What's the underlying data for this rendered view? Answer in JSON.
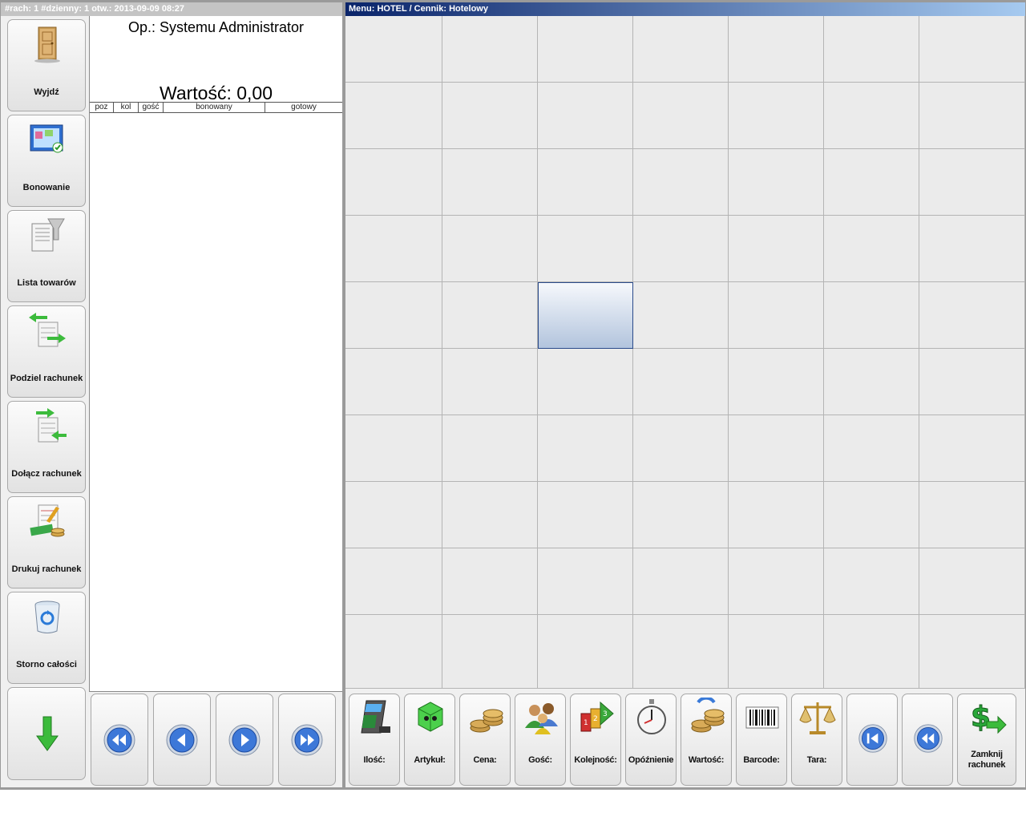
{
  "left_title": "#rach: 1 #dzienny: 1 otw.: 2013-09-09 08:27",
  "operator": "Op.: Systemu Administrator",
  "total": "Wartość: 0,00",
  "columns": [
    "poz",
    "kol",
    "gość",
    "bonowany",
    "gotowy"
  ],
  "sidebar": [
    {
      "label": "Wyjdź",
      "icon": "door-icon"
    },
    {
      "label": "Bonowanie",
      "icon": "order-screen-icon"
    },
    {
      "label": "Lista towarów",
      "icon": "product-list-icon"
    },
    {
      "label": "Podziel rachunek",
      "icon": "split-bill-icon"
    },
    {
      "label": "Dołącz rachunek",
      "icon": "merge-bill-icon"
    },
    {
      "label": "Drukuj rachunek",
      "icon": "print-bill-icon"
    },
    {
      "label": "Storno całości",
      "icon": "recycle-bin-icon"
    }
  ],
  "sidebar_scroll_icon": "arrow-down-icon",
  "order_nav_icons": [
    "rewind-icon",
    "previous-icon",
    "next-icon",
    "fast-forward-icon"
  ],
  "right_title": "Menu: HOTEL / Cennik: Hotelowy",
  "grid": {
    "rows": 10,
    "cols": 7,
    "selected_row": 4,
    "selected_col": 2
  },
  "function_buttons": [
    {
      "label": "Ilość:",
      "icon": "calculator-icon"
    },
    {
      "label": "Artykuł:",
      "icon": "article-icon"
    },
    {
      "label": "Cena:",
      "icon": "coins-icon"
    },
    {
      "label": "Gość:",
      "icon": "guests-icon"
    },
    {
      "label": "Kolejność:",
      "icon": "sequence-icon"
    },
    {
      "label": "Opóźnienie",
      "icon": "stopwatch-icon"
    },
    {
      "label": "Wartość:",
      "icon": "value-coins-icon"
    },
    {
      "label": "Barcode:",
      "icon": "barcode-icon"
    },
    {
      "label": "Tara:",
      "icon": "scale-icon"
    }
  ],
  "right_nav_icons": [
    "first-page-icon",
    "rewind-icon"
  ],
  "close_bill": {
    "label": "Zamknij rachunek",
    "icon": "dollar-arrow-icon"
  },
  "colors": {
    "title_gradient_start": "#0a246a",
    "title_gradient_end": "#a6caf0",
    "selected_cell": "#b2c4dd"
  }
}
